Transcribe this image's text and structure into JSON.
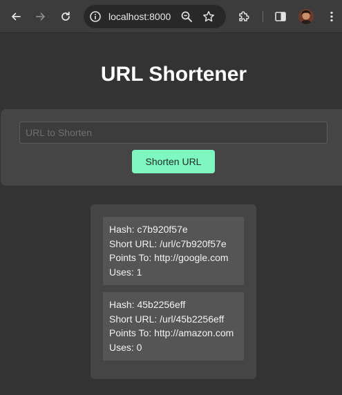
{
  "browser": {
    "url": "localhost:8000",
    "icons": {
      "back": "back-arrow-icon",
      "forward": "forward-arrow-icon",
      "reload": "reload-icon",
      "site_info": "site-info-icon",
      "zoom": "zoom-icon",
      "bookmark": "star-icon",
      "extensions": "puzzle-piece-icon",
      "side_panel": "side-panel-icon",
      "menu": "kebab-menu-icon"
    }
  },
  "page": {
    "title": "URL Shortener",
    "form": {
      "placeholder": "URL to Shorten",
      "value": "",
      "button_label": "Shorten URL"
    },
    "entries": [
      {
        "hash": "Hash: c7b920f57e",
        "short_url": "Short URL: /url/c7b920f57e",
        "points_to": "Points To: http://google.com",
        "uses": "Uses: 1"
      },
      {
        "hash": "Hash: 45b2256eff",
        "short_url": "Short URL: /url/45b2256eff",
        "points_to": "Points To: http://amazon.com",
        "uses": "Uses: 0"
      }
    ]
  },
  "colors": {
    "page_bg": "#333333",
    "card_bg": "#454545",
    "entry_bg": "#555555",
    "button_accent": "#7ef7c0"
  }
}
